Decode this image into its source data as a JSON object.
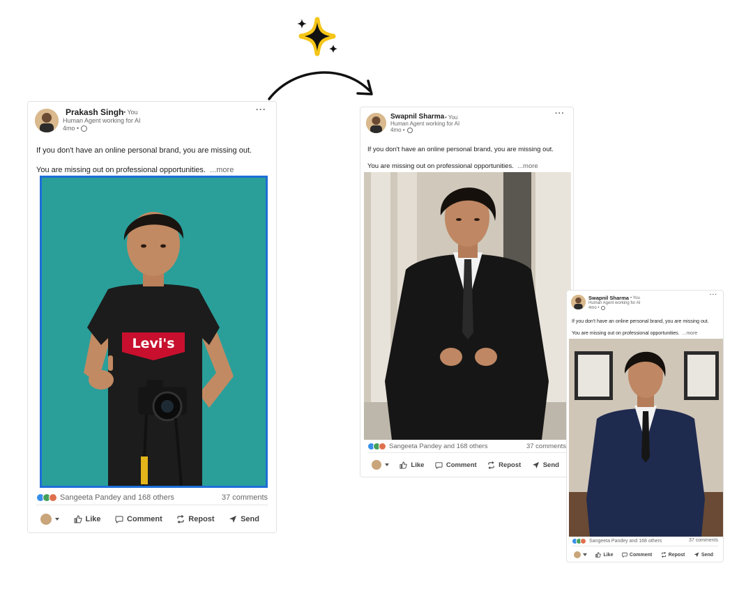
{
  "posts": [
    {
      "name": "Prakash Singh",
      "you": "• You",
      "headline": "Human Agent working for AI",
      "time": "4mo •",
      "line1": "If you don't have an online personal brand, you are missing out.",
      "line2": "You are missing out on professional opportunities.",
      "more": "...more",
      "reactions": "Sangeeta Pandey and 168 others",
      "comments": "37 comments",
      "actions": {
        "like": "Like",
        "comment": "Comment",
        "repost": "Repost",
        "send": "Send"
      }
    },
    {
      "name": "Swapnil Sharma",
      "you": "• You",
      "headline": "Human Agent working for AI",
      "time": "4mo •",
      "line1": "If you don't have an online personal brand, you are missing out.",
      "line2": "You are missing out on professional opportunities.",
      "more": "...more",
      "reactions": "Sangeeta Pandey and 168 others",
      "comments": "37 comments",
      "actions": {
        "like": "Like",
        "comment": "Comment",
        "repost": "Repost",
        "send": "Send"
      }
    },
    {
      "name": "Swapnil Sharma",
      "you": "• You",
      "headline": "Human Agent working for AI",
      "time": "4mo •",
      "line1": "If you don't have an online personal brand, you are missing out.",
      "line2": "You are missing out on professional opportunities.",
      "more": "...more",
      "reactions": "Sangeeta Pandey and 168 others",
      "comments": "37 comments",
      "actions": {
        "like": "Like",
        "comment": "Comment",
        "repost": "Repost",
        "send": "Send"
      }
    }
  ],
  "shirt_logo": "Levi's",
  "colors": {
    "teal_background": "#2a9f9a",
    "photo_border": "#1d6ed8",
    "sparkle_fill": "#111111",
    "sparkle_glow": "#f5c518",
    "like_blue": "#378fe9",
    "celebrate_green": "#44a05b",
    "heart_red": "#df704d"
  },
  "icons": [
    "more-dots-icon",
    "globe-icon",
    "like-icon",
    "comment-icon",
    "repost-icon",
    "send-icon",
    "sparkle-icon",
    "arrow-icon"
  ]
}
